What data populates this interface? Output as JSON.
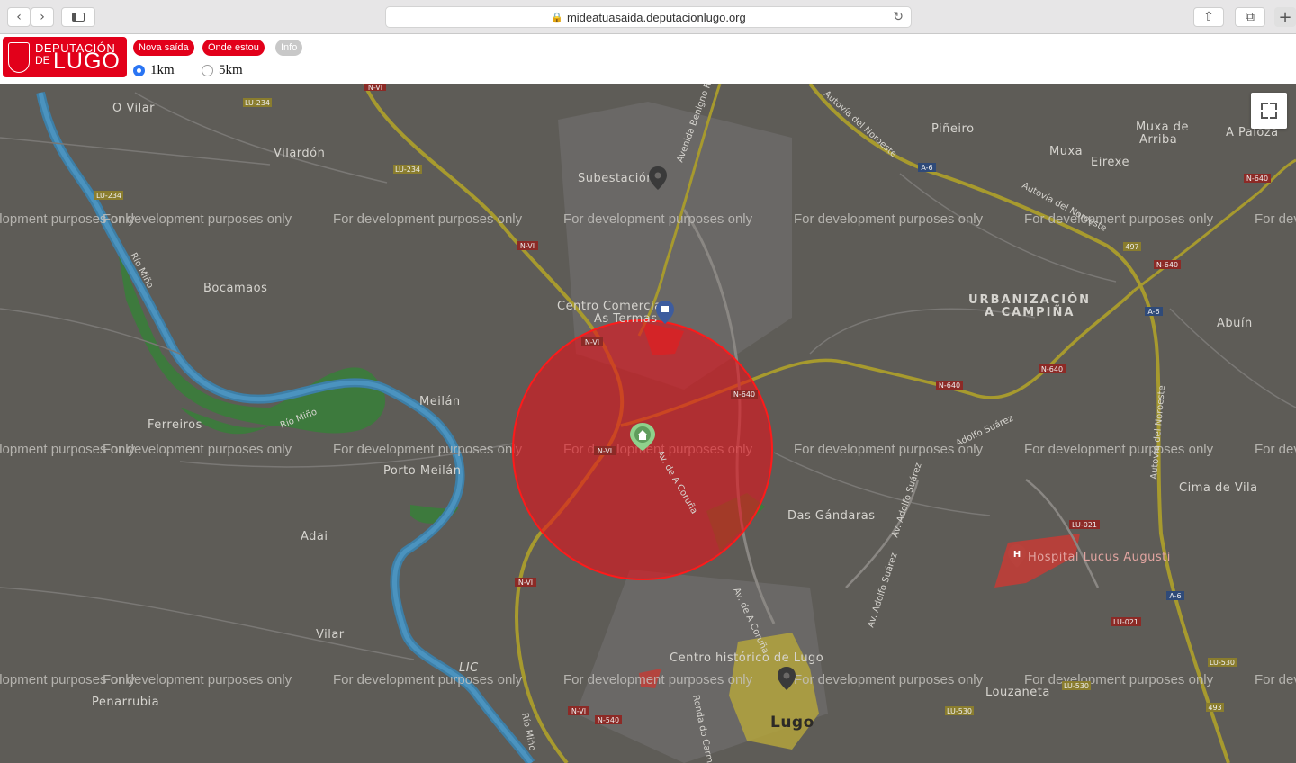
{
  "browser": {
    "url": "mideatuasaida.deputacionlugo.org",
    "back_icon": "‹",
    "forward_icon": "›"
  },
  "header": {
    "logo": {
      "line1": "DEPUTACIÓN",
      "line2": "DE",
      "line3": "LUGO"
    },
    "buttons": [
      {
        "label": "Nova saída",
        "color": "#e2001a"
      },
      {
        "label": "Onde estou",
        "color": "#e2001a"
      },
      {
        "label": "Info",
        "color": "#c8c8c8"
      }
    ],
    "radius_options": [
      {
        "label": "1km",
        "selected": true
      },
      {
        "label": "5km",
        "selected": false
      }
    ]
  },
  "map": {
    "watermark": "For development purposes only",
    "circle_color": "#e2141c",
    "places": [
      "O Vilar",
      "Vilardón",
      "Subestación",
      "Piñeiro",
      "Muxa de",
      "Arriba",
      "A Paloza",
      "Muxa",
      "Eirexe",
      "Bocamaos",
      "URBANIZACIÓN",
      "A CAMPIÑA",
      "Abuín",
      "Centro Comercial",
      "As Termas",
      "Meilán",
      "Ferreiros",
      "Porto Meilán",
      "Adai",
      "Das Gándaras",
      "Cima de Vila",
      "Hospital Lucus Augusti",
      "Vilar",
      "LIC",
      "Penarrubia",
      "Centro histórico de Lugo",
      "Louzaneta",
      "Lugo"
    ],
    "road_names": [
      "Avenida Benigno R",
      "Autovía del Noroeste",
      "Autovía del Noroeste",
      "Autovía del Noroeste",
      "Río Miño",
      "Río Miño",
      "Río Miño",
      "Av. de A Coruña",
      "Av. de A Coruña",
      "Av. Adolfo Suárez",
      "Av. Adolfo Suárez",
      "Adolfo Suárez",
      "Ronda do Carme"
    ],
    "road_shields": [
      "LU-234",
      "LU-234",
      "LU-234",
      "N-VI",
      "N-VI",
      "N-VI",
      "N-VI",
      "N-VI",
      "N-VI",
      "A-6",
      "A-6",
      "A-6",
      "N-640",
      "N-640",
      "N-640",
      "N-640",
      "N-640",
      "N-540",
      "497",
      "493",
      "LU-021",
      "LU-021",
      "LU-530",
      "LU-530",
      "LU-530"
    ],
    "icons": [
      "pin-icon",
      "shopping-pin-icon",
      "home-marker-icon",
      "hospital-icon",
      "pin-icon",
      "fullscreen-icon"
    ]
  }
}
